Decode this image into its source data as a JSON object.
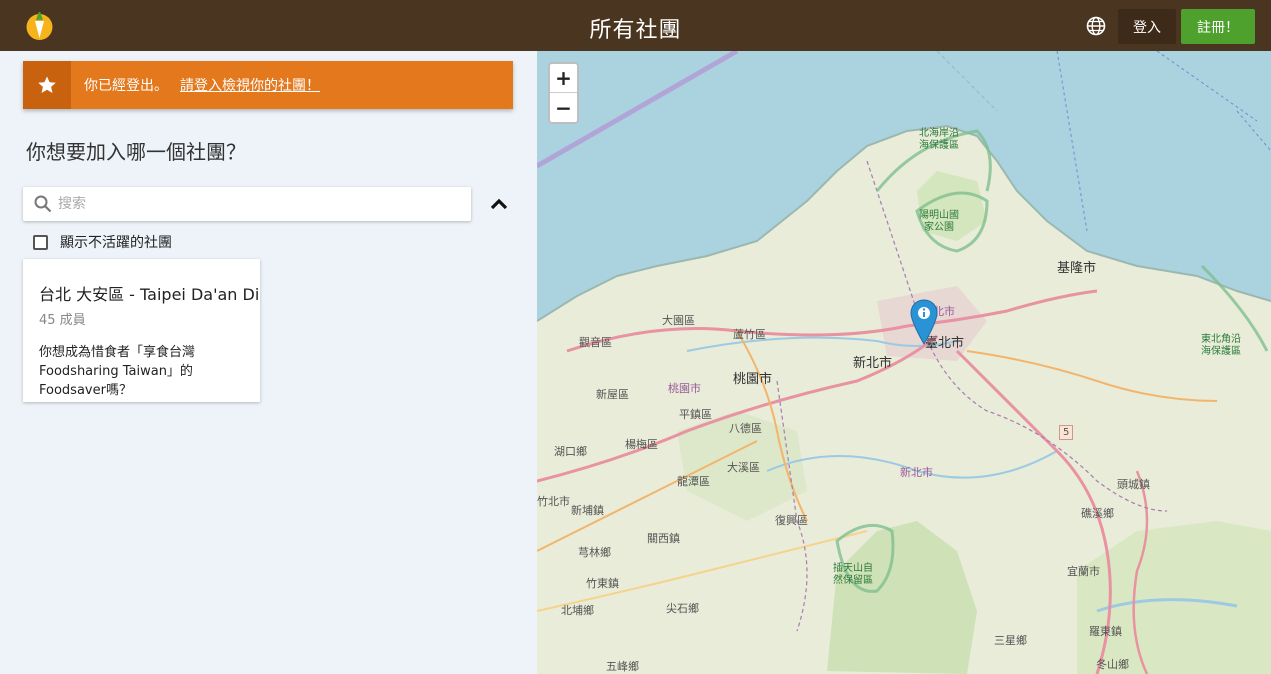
{
  "header": {
    "title": "所有社團",
    "login_label": "登入",
    "signup_label": "註冊！"
  },
  "notice": {
    "text": "你已經登出。",
    "link": "請登入檢視你的社團！"
  },
  "sidebar": {
    "question": "你想要加入哪一個社團？",
    "search_placeholder": "搜索",
    "show_inactive_label": "顯示不活躍的社團"
  },
  "groups": [
    {
      "name": "台北 大安區 - Taipei Da'an District",
      "members": "45 成員",
      "description": "你想成為惜食者「享食台灣 Foodsharing Taiwan」的 Foodsaver嗎？"
    }
  ],
  "map": {
    "zoom_in": "+",
    "zoom_out": "−",
    "labels": {
      "bei_hai": "北海岸沿\n海保護區",
      "yangming": "陽明山國\n家公園",
      "keelung": "基隆市",
      "taipei": "臺北市",
      "taipei_small": "北市",
      "newtaipei": "新北市",
      "newtaipei2": "新北市",
      "dayuan": "大園區",
      "luzhu": "蘆竹區",
      "guanyin": "觀音區",
      "taoyuan": "桃園市",
      "taoyuan_small": "桃園市",
      "xinwu": "新屋區",
      "pingzhen": "平鎮區",
      "bade": "八德區",
      "yangmei": "楊梅區",
      "hukou": "湖口鄉",
      "longtan": "龍潭區",
      "daxi": "大溪區",
      "hsinchu_city": "竹北市",
      "xinpu": "新埔鎮",
      "fuxing": "復興區",
      "guanxi": "關西鎮",
      "qionglin": "芎林鄉",
      "zhudong": "竹東鎮",
      "jianshi": "尖石鄉",
      "beipu": "北埔鄉",
      "wufeng": "五峰鄉",
      "dongbei": "東北角沿\n海保護區",
      "toucheng": "頭城鎮",
      "jiaoxi": "礁溪鄉",
      "yilan": "宜蘭市",
      "luodong": "羅東鎮",
      "sanxing": "三星鄉",
      "dongshan": "冬山鄉",
      "chatian": "插天山自\n然保留區",
      "route5": "5"
    }
  },
  "colors": {
    "header_bg": "#4a3520",
    "notice_bg": "#e4781d",
    "signup_bg": "#4fa12e",
    "marker": "#2a93d5"
  }
}
